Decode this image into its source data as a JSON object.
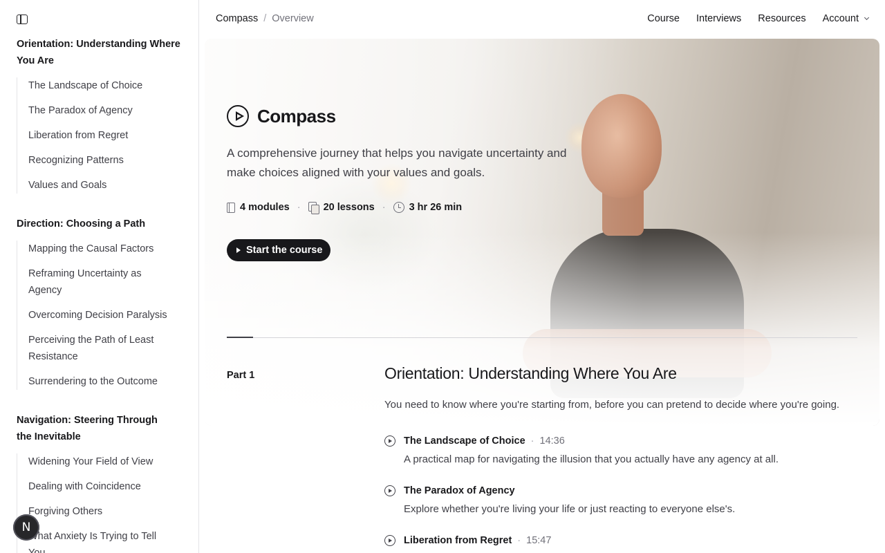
{
  "sidebar": {
    "sections": [
      {
        "title": "Orientation: Understanding Where You Are",
        "items": [
          "The Landscape of Choice",
          "The Paradox of Agency",
          "Liberation from Regret",
          "Recognizing Patterns",
          "Values and Goals"
        ]
      },
      {
        "title": "Direction: Choosing a Path",
        "items": [
          "Mapping the Causal Factors",
          "Reframing Uncertainty as Agency",
          "Overcoming Decision Paralysis",
          "Perceiving the Path of Least Resistance",
          "Surrendering to the Outcome"
        ]
      },
      {
        "title": "Navigation: Steering Through the Inevitable",
        "items": [
          "Widening Your Field of View",
          "Dealing with Coincidence",
          "Forgiving Others",
          "What Anxiety Is Trying to Tell You"
        ]
      }
    ],
    "fab_label": "N"
  },
  "breadcrumb": {
    "root": "Compass",
    "separator": "/",
    "current": "Overview"
  },
  "nav": {
    "course": "Course",
    "interviews": "Interviews",
    "resources": "Resources",
    "account": "Account"
  },
  "hero": {
    "brand": "Compass",
    "description": "A comprehensive journey that helps you navigate uncertainty and make choices aligned with your values and goals.",
    "stats": {
      "modules": "4 modules",
      "lessons": "20 lessons",
      "duration": "3 hr 26 min",
      "separator": "·"
    },
    "cta": "Start the course"
  },
  "part": {
    "label": "Part 1",
    "title": "Orientation: Understanding Where You Are",
    "description": "You need to know where you're starting from, before you can pretend to decide where you're going.",
    "lessons": [
      {
        "title": "The Landscape of Choice",
        "duration": "14:36",
        "description": "A practical map for navigating the illusion that you actually have any agency at all."
      },
      {
        "title": "The Paradox of Agency",
        "duration": "",
        "description": "Explore whether you're living your life or just reacting to everyone else's."
      },
      {
        "title": "Liberation from Regret",
        "duration": "15:47",
        "description": ""
      }
    ]
  },
  "icons": [
    "sidebar-toggle-icon",
    "play-circle-icon",
    "book-icon",
    "copy-icon",
    "clock-icon",
    "chevron-down-icon"
  ]
}
